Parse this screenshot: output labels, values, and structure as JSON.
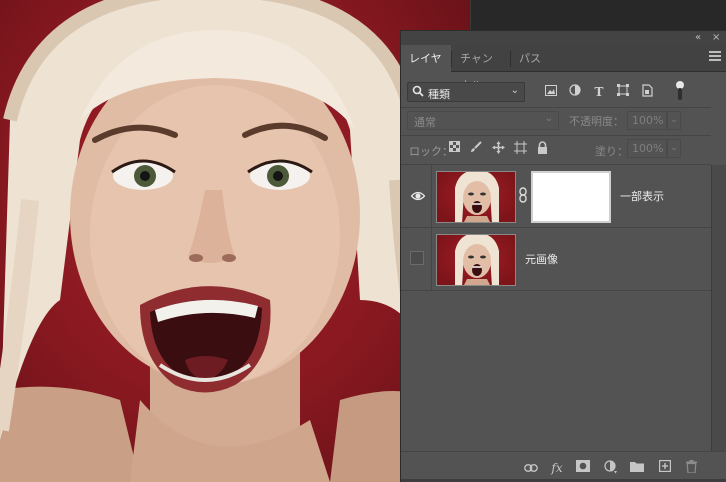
{
  "panel": {
    "tabs": [
      {
        "label": "レイヤー",
        "active": true
      },
      {
        "label": "チャンネル",
        "active": false
      },
      {
        "label": "パス",
        "active": false
      }
    ],
    "collapse_icon": "«",
    "close_icon": "×"
  },
  "filter": {
    "kind_label": "種類",
    "icons": [
      "image-filter-icon",
      "adjustment-filter-icon",
      "type-filter-icon",
      "shape-filter-icon",
      "smart-object-filter-icon"
    ],
    "type_glyph": "T"
  },
  "blend": {
    "mode": "通常",
    "opacity_label": "不透明度：",
    "opacity": "100%"
  },
  "lock": {
    "label": "ロック：",
    "fill_label": "塗り：",
    "fill": "100%"
  },
  "layers": [
    {
      "name": "一部表示",
      "visible": true,
      "has_mask": true
    },
    {
      "name": "元画像",
      "visible": false,
      "has_mask": false
    }
  ],
  "bottom_bar": {
    "fx_label": "fx",
    "icons": [
      "link-layers-icon",
      "fx-icon",
      "add-mask-icon",
      "adjustment-layer-icon",
      "new-group-icon",
      "new-layer-icon",
      "delete-layer-icon"
    ]
  },
  "colors": {
    "panel_bg": "#535353",
    "tab_bar_bg": "#424242",
    "photo_bg": "#8f1a22",
    "mask_white": "#ffffff"
  }
}
